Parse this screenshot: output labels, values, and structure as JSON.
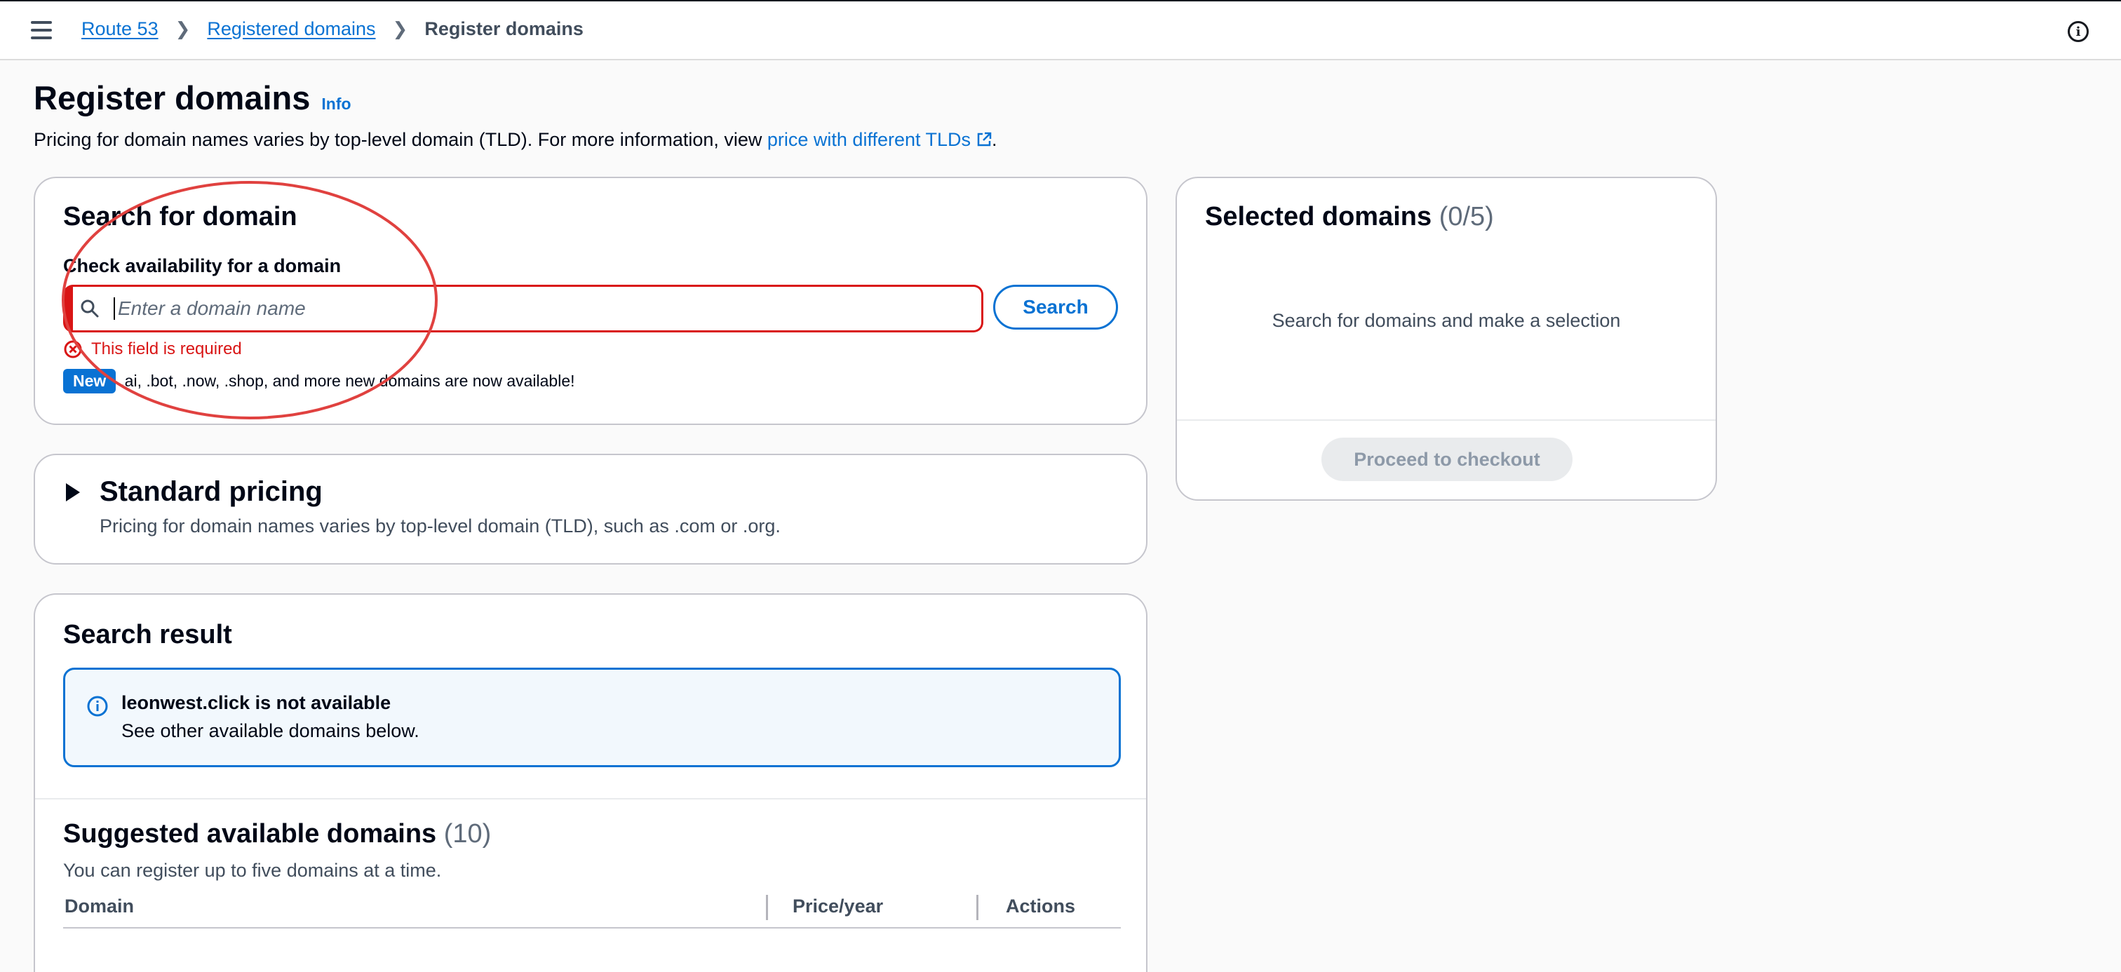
{
  "header": {
    "breadcrumb": [
      "Route 53",
      "Registered domains",
      "Register domains"
    ],
    "separator": ">"
  },
  "page": {
    "title": "Register domains",
    "info_link": "Info",
    "description_prefix": "Pricing for domain names varies by top-level domain (TLD). For more information, view ",
    "description_link": "price with different TLDs",
    "description_suffix": "."
  },
  "search_card": {
    "title": "Search for domain",
    "field_label": "Check availability for a domain",
    "input_value": "",
    "input_placeholder": "Enter a domain name",
    "search_button": "Search",
    "error_text": "This field is required",
    "badge": "New",
    "new_text": ".ai, .bot, .now, .shop, and more new domains are now available!"
  },
  "pricing_card": {
    "title": "Standard pricing",
    "description": "Pricing for domain names varies by top-level domain (TLD), such as .com or .org."
  },
  "result_card": {
    "title": "Search result",
    "alert_title": "leonwest.click is not available",
    "alert_body": "See other available domains below.",
    "suggest_title": "Suggested available domains",
    "suggest_count": "(10)",
    "suggest_desc": "You can register up to five domains at a time.",
    "columns": [
      "Domain",
      "Price/year",
      "Actions"
    ]
  },
  "selected_card": {
    "title": "Selected domains",
    "count": "(0/5)",
    "empty_text": "Search for domains and make a selection",
    "checkout_button": "Proceed to checkout"
  },
  "colors": {
    "link": "#0972d3",
    "error": "#d91515",
    "annotation": "#e0413f"
  }
}
